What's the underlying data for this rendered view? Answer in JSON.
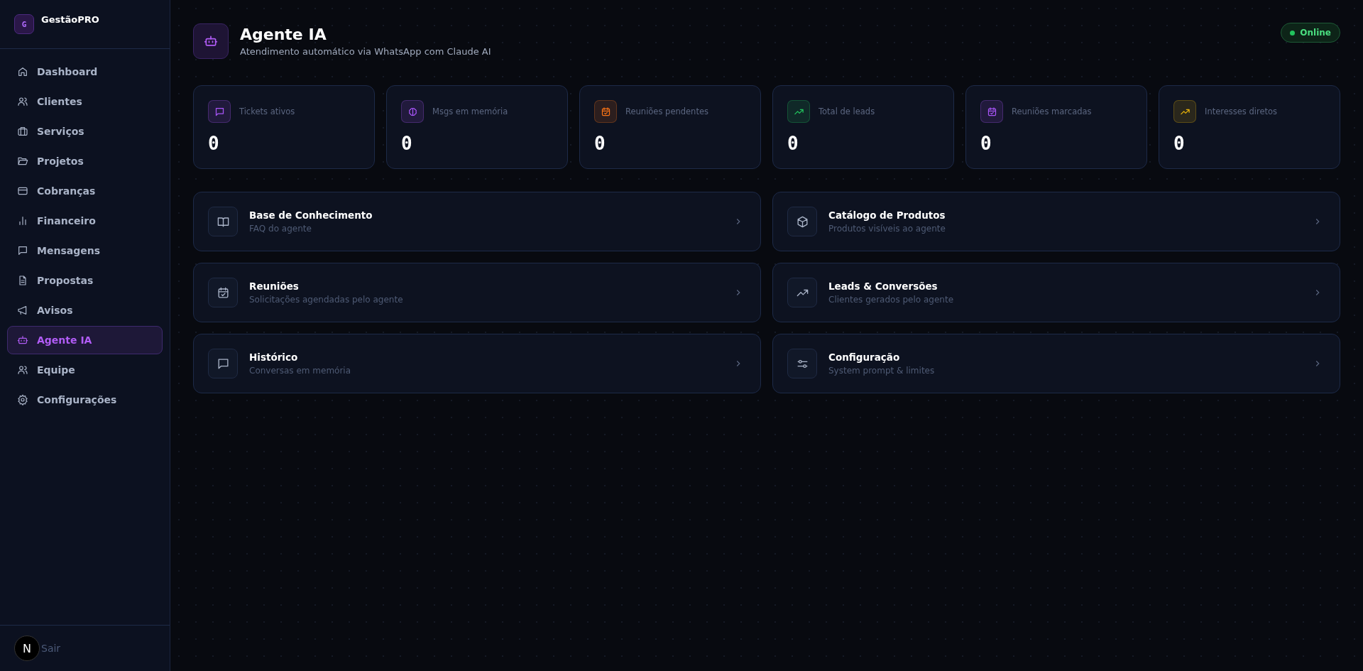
{
  "brand": {
    "initial": "G",
    "name": "GestãoPRO"
  },
  "sidebar": {
    "items": [
      {
        "label": "Dashboard",
        "selected": false
      },
      {
        "label": "Clientes",
        "selected": false
      },
      {
        "label": "Serviços",
        "selected": false
      },
      {
        "label": "Projetos",
        "selected": false
      },
      {
        "label": "Cobranças",
        "selected": false
      },
      {
        "label": "Financeiro",
        "selected": false
      },
      {
        "label": "Mensagens",
        "selected": false
      },
      {
        "label": "Propostas",
        "selected": false
      },
      {
        "label": "Avisos",
        "selected": false
      },
      {
        "label": "Agente IA",
        "selected": true
      },
      {
        "label": "Equipe",
        "selected": false
      },
      {
        "label": "Configurações",
        "selected": false
      }
    ],
    "logout": "Sair",
    "dev_badge": "N"
  },
  "header": {
    "title": "Agente IA",
    "subtitle": "Atendimento automático via WhatsApp com Claude AI",
    "status": "Online"
  },
  "stats": [
    {
      "label": "Tickets ativos",
      "value": "0",
      "color": "#a855f7"
    },
    {
      "label": "Msgs em memória",
      "value": "0",
      "color": "#a855f7"
    },
    {
      "label": "Reuniões pendentes",
      "value": "0",
      "color": "#f97316"
    },
    {
      "label": "Total de leads",
      "value": "0",
      "color": "#22c55e"
    },
    {
      "label": "Reuniões marcadas",
      "value": "0",
      "color": "#a855f7"
    },
    {
      "label": "Interesses diretos",
      "value": "0",
      "color": "#eab308"
    }
  ],
  "sections": [
    {
      "title": "Base de Conhecimento",
      "subtitle": "FAQ do agente"
    },
    {
      "title": "Catálogo de Produtos",
      "subtitle": "Produtos visíveis ao agente"
    },
    {
      "title": "Reuniões",
      "subtitle": "Solicitações agendadas pelo agente"
    },
    {
      "title": "Leads & Conversões",
      "subtitle": "Clientes gerados pelo agente"
    },
    {
      "title": "Histórico",
      "subtitle": "Conversas em memória"
    },
    {
      "title": "Configuração",
      "subtitle": "System prompt & limites"
    }
  ]
}
